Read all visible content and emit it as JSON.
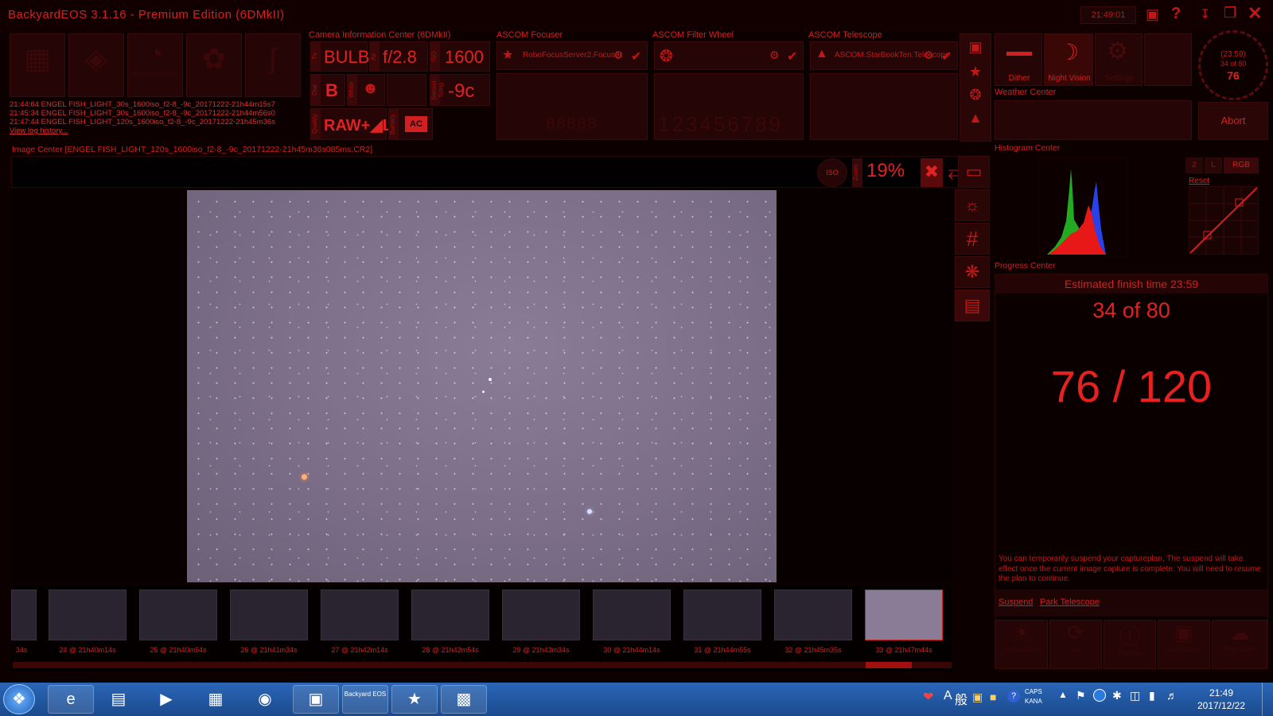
{
  "app": {
    "title": "BackyardEOS 3.1.16 - Premium Edition (6DMkII)",
    "clock": "21:49:01"
  },
  "toolbar": {
    "labels": [
      "",
      "",
      "Premium Focus",
      "",
      ""
    ]
  },
  "log": {
    "lines": [
      "21:44:64 ENGEL FISH_LIGHT_30s_1600iso_f2-8_-9c_20171222-21h44m15s7",
      "21:45:34 ENGEL FISH_LIGHT_30s_1600iso_f2-8_-9c_20171222-21h44m56s0",
      "21:47:44 ENGEL FISH_LIGHT_120s_1600iso_f2-8_-9c_20171222-21h45m36s"
    ],
    "history_link": "View log history..."
  },
  "camera": {
    "title": "Camera Information Center (6DMkII)",
    "tv_tag": "Tv",
    "tv": "BULB",
    "av_tag": "Av",
    "av": "f/2.8",
    "iso_tag": "ISO",
    "iso": "1600",
    "dial_tag": "Dial",
    "mode": "B",
    "wb_tag": "White",
    "sensor_tag": "Sensor Temp",
    "temp": "-9c",
    "quality_tag": "Quality",
    "quality": "RAW+◢L",
    "battery_tag": "Battery",
    "battery": "AC"
  },
  "focuser": {
    "title": "ASCOM Focuser",
    "device": "RoboFocusServer2.Focuser",
    "position_digits": "88888"
  },
  "filterwheel": {
    "title": "ASCOM Filter Wheel",
    "digits": "123456789"
  },
  "telescope": {
    "title": "ASCOM Telescope",
    "device": "ASCOM.StarBookTen.Telescope"
  },
  "tools": {
    "dither": "Dither",
    "night_vision": "Night Vision",
    "settings": "Settings"
  },
  "dial": {
    "time": "(23:59)",
    "progress": "34 of 80",
    "value": "76"
  },
  "weather": {
    "title": "Weather Center"
  },
  "abort": "Abort",
  "image": {
    "title": "Image Center [ENGEL FISH_LIGHT_120s_1600iso_f2-8_-9c_20171222-21h45m36s085ms.CR2]",
    "zoom_tag": "Zoom",
    "zoom": "19%",
    "iso_badge": "ISO"
  },
  "histogram": {
    "title": "Histogram Center",
    "btn_2": "2",
    "btn_l": "L",
    "btn_rgb": "RGB",
    "reset": "Reset"
  },
  "progress": {
    "title": "Progress Center",
    "finish": "Estimated finish time 23:59",
    "count": "34 of 80",
    "exposure": "76 / 120",
    "exposure_fraction": 0.633,
    "note": "You can temporarily suspend your captureplan.  The suspend will take effect once the current image capture is complete.  You will need to resume the plan to continue.",
    "suspend": "Suspend",
    "park": "Park Telescope",
    "buttons": [
      "Start Capture",
      "Loop",
      "Preview",
      "Auto Capture",
      "Take Darks"
    ]
  },
  "thumbs": {
    "labels": [
      "34s",
      "24 @ 21h40m14s",
      "25 @ 21h40m54s",
      "26 @ 21h41m34s",
      "27 @ 21h42m14s",
      "28 @ 21h42m54s",
      "29 @ 21h43m34s",
      "30 @ 21h44m14s",
      "31 @ 21h44m55s",
      "32 @ 21h45m35s",
      "33 @ 21h47m44s"
    ],
    "scroll_fraction": 0.955
  },
  "taskbar": {
    "ime_a": "A",
    "ime_kanji": "般",
    "caps": "CAPS",
    "kana": "KANA",
    "time": "21:49",
    "date": "2017/12/22",
    "app_icon_text": "Backyard EOS",
    "icons": [
      "start-orb-icon",
      "internet-explorer-icon",
      "file-explorer-icon",
      "media-player-icon",
      "calculator-icon",
      "chrome-icon",
      "camera-icon",
      "backyard-eos-icon",
      "telescope-app-icon",
      "remote-desktop-icon"
    ]
  },
  "colors": {
    "theme_red": "#d02020",
    "background": "#0c0000",
    "taskbar": "#1f56a0",
    "panel": "#1a0303"
  }
}
